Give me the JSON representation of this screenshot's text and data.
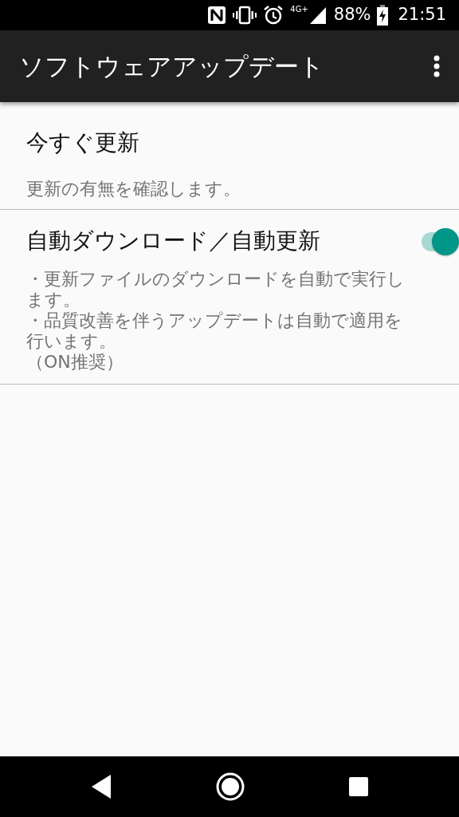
{
  "status_bar": {
    "network": "4G+",
    "battery": "88%",
    "time": "21:51"
  },
  "app_bar": {
    "title": "ソフトウェアアップデート"
  },
  "preferences": [
    {
      "kind": "action",
      "title": "今すぐ更新",
      "summary": [
        "更新の有無を確認します。"
      ]
    },
    {
      "kind": "switch",
      "title": "自動ダウンロード／自動更新",
      "on": true,
      "summary": [
        "・更新ファイルのダウンロードを自動で実行します。",
        "・品質改善を伴うアップデートは自動で適用を行います。",
        "（ON推奨）"
      ]
    }
  ]
}
